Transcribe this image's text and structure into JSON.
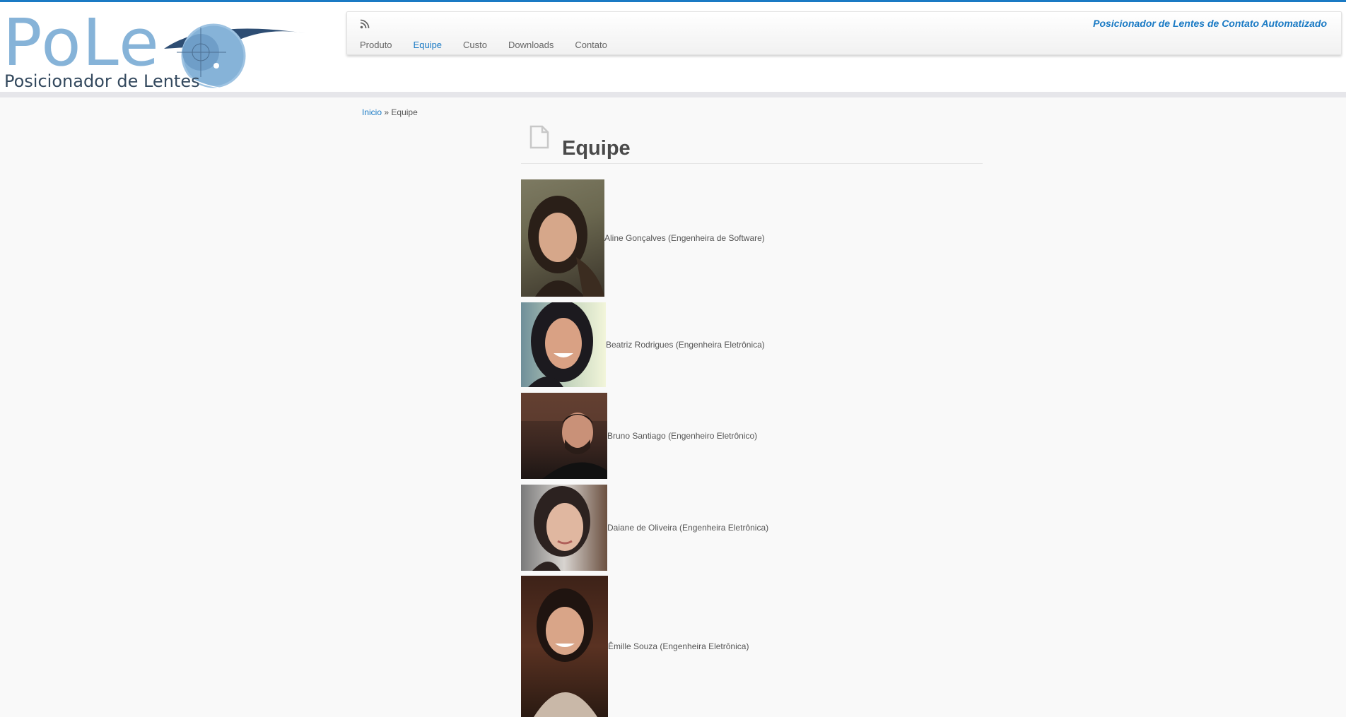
{
  "brand": {
    "logo_word": "PoLe",
    "logo_subtitle": "Posicionador de Lentes",
    "tagline": "Posicionador de Lentes de Contato Automatizado"
  },
  "nav": {
    "items": [
      {
        "label": "Produto",
        "active": false
      },
      {
        "label": "Equipe",
        "active": true
      },
      {
        "label": "Custo",
        "active": false
      },
      {
        "label": "Downloads",
        "active": false
      },
      {
        "label": "Contato",
        "active": false
      }
    ]
  },
  "breadcrumb": {
    "home": "Inicio",
    "separator": "»",
    "current": "Equipe"
  },
  "page": {
    "title": "Equipe"
  },
  "team": [
    {
      "caption": "Aline Gonçalves (Engenheira de Software)"
    },
    {
      "caption": "Beatriz Rodrigues (Engenheira Eletrônica)"
    },
    {
      "caption": "Bruno Santiago (Engenheiro Eletrônico)"
    },
    {
      "caption": "Daiane de Oliveira (Engenheira Eletrônica)"
    },
    {
      "caption": "Êmille Souza (Engenheira Eletrônica)"
    }
  ],
  "colors": {
    "accent": "#1a7ac4",
    "logo_light": "#86b3d8",
    "logo_dark": "#34495e"
  }
}
